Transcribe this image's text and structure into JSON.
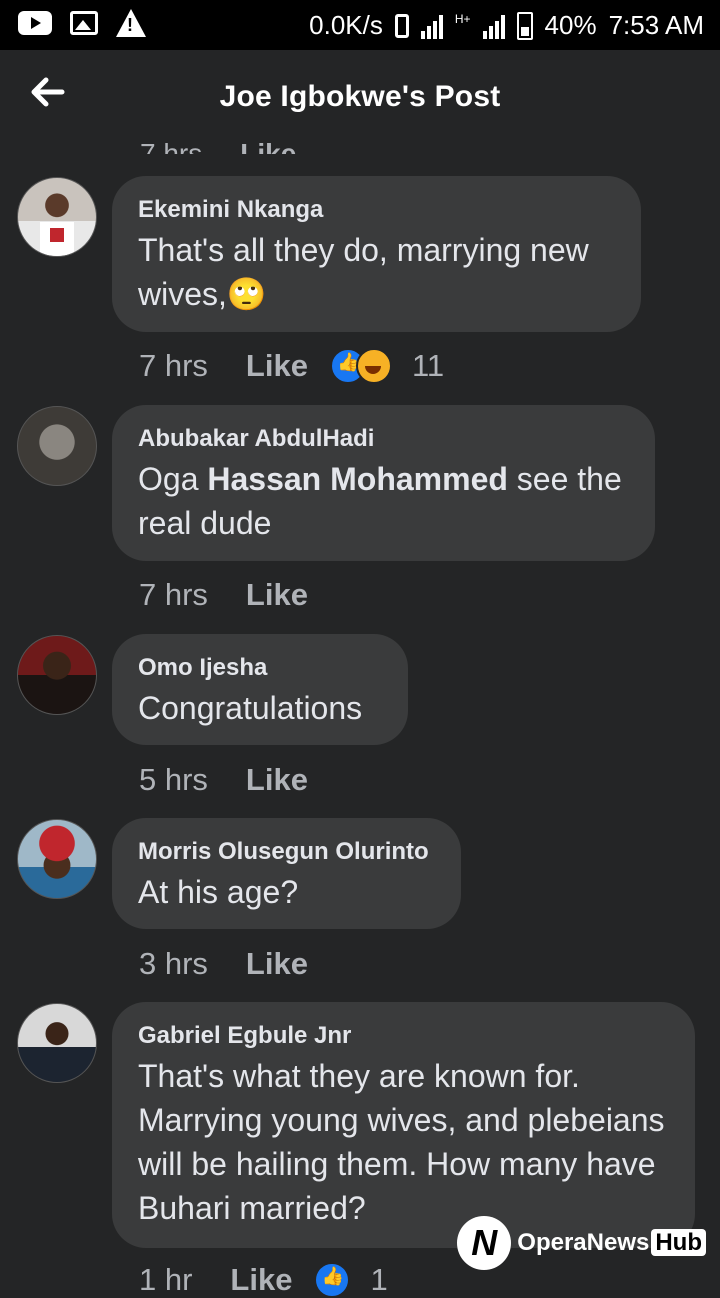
{
  "status_bar": {
    "network_speed": "0.0K/s",
    "network_type": "H+",
    "battery": "40%",
    "time": "7:53 AM",
    "icons": [
      "youtube-icon",
      "image-icon",
      "warning-icon",
      "vibrate-icon",
      "signal-icon",
      "battery-icon"
    ]
  },
  "header": {
    "title": "Joe Igbokwe's Post",
    "back_icon": "arrow-left-icon"
  },
  "prev_meta": {
    "time": "7 hrs",
    "like": "Like"
  },
  "comments": [
    {
      "author": "Ekemini Nkanga",
      "text": "That's all they do, marrying new wives,🙄",
      "time": "7 hrs",
      "like": "Like",
      "reactions": [
        "like",
        "haha"
      ],
      "reaction_count": "11"
    },
    {
      "author": "Abubakar AbdulHadi",
      "text_before": "Oga ",
      "mention": "Hassan Mohammed",
      "text_after": " see the real dude",
      "time": "7 hrs",
      "like": "Like"
    },
    {
      "author": "Omo Ijesha",
      "text": "Congratulations",
      "time": "5 hrs",
      "like": "Like"
    },
    {
      "author": "Morris Olusegun Olurinto",
      "text": "At his age?",
      "time": "3 hrs",
      "like": "Like"
    },
    {
      "author": "Gabriel Egbule Jnr",
      "text": "That's what they are known for. Marrying young wives, and plebeians will be hailing them. How many have Buhari married?",
      "time": "1 hr",
      "like": "Like",
      "reactions": [
        "like"
      ],
      "reaction_count": "1"
    }
  ],
  "watermark": {
    "brand": "OperaNews",
    "hub": "Hub"
  },
  "colors": {
    "background": "#242526",
    "bubble": "#3a3b3c",
    "text": "#e4e6eb",
    "meta": "#b0b3b8",
    "like_blue": "#1877f2"
  }
}
